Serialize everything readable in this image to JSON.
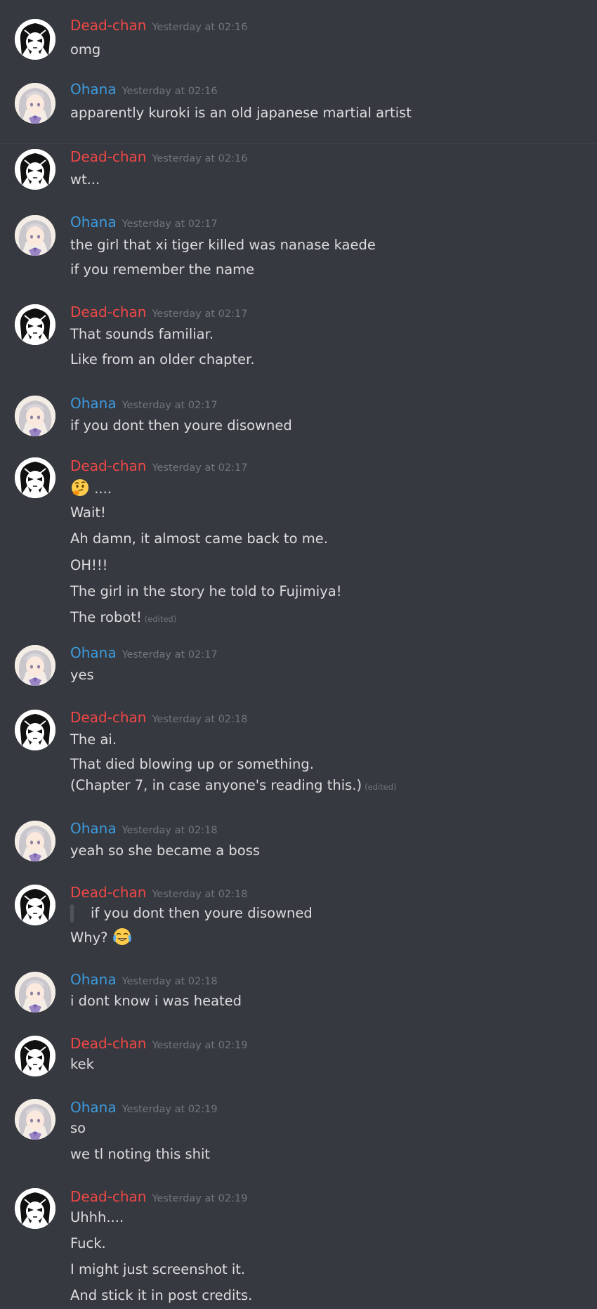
{
  "authors": {
    "dead": "Dead-chan",
    "ohana": "Ohana"
  },
  "messages": [
    {
      "author": "Dead-chan",
      "timestamp": "Yesterday at 02:16",
      "lines": [
        "omg"
      ]
    },
    {
      "author": "Ohana",
      "timestamp": "Yesterday at 02:16",
      "lines": [
        "apparently kuroki is an old japanese martial artist"
      ]
    },
    {
      "author": "Dead-chan",
      "timestamp": "Yesterday at 02:16",
      "lines": [
        "wt..."
      ]
    },
    {
      "author": "Ohana",
      "timestamp": "Yesterday at 02:17",
      "lines": [
        "the girl that xi tiger killed was nanase kaede",
        "if you remember the name"
      ]
    },
    {
      "author": "Dead-chan",
      "timestamp": "Yesterday at 02:17",
      "lines": [
        "That sounds familiar.",
        "Like from an older chapter."
      ]
    },
    {
      "author": "Ohana",
      "timestamp": "Yesterday at 02:17",
      "lines": [
        "if you dont then youre disowned"
      ]
    },
    {
      "author": "Dead-chan",
      "timestamp": "Yesterday at 02:17",
      "lines": [
        "....",
        "Wait!",
        "Ah damn, it almost came back to me.",
        "OH!!!",
        "The girl in the story he told to Fujimiya!",
        "The robot!"
      ],
      "edited": "(edited)",
      "emoji": "thinking-emoji"
    },
    {
      "author": "Ohana",
      "timestamp": "Yesterday at 02:17",
      "lines": [
        "yes"
      ]
    },
    {
      "author": "Dead-chan",
      "timestamp": "Yesterday at 02:18",
      "lines": [
        "The ai.",
        "That died blowing up or something.",
        "(Chapter 7, in case anyone's reading this.)"
      ],
      "edited": "(edited)"
    },
    {
      "author": "Ohana",
      "timestamp": "Yesterday at 02:18",
      "lines": [
        "yeah so she became a boss"
      ]
    },
    {
      "author": "Dead-chan",
      "timestamp": "Yesterday at 02:18",
      "lines": [
        "if you dont then youre disowned",
        "Why?"
      ],
      "quote": true,
      "emoji": "joy-emoji"
    },
    {
      "author": "Ohana",
      "timestamp": "Yesterday at 02:18",
      "lines": [
        "i dont know i was heated"
      ]
    },
    {
      "author": "Dead-chan",
      "timestamp": "Yesterday at 02:19",
      "lines": [
        "kek"
      ]
    },
    {
      "author": "Ohana",
      "timestamp": "Yesterday at 02:19",
      "lines": [
        "so",
        "we tl noting this shit"
      ]
    },
    {
      "author": "Dead-chan",
      "timestamp": "Yesterday at 02:19",
      "lines": [
        "Uhhh....",
        "Fuck.",
        "I might just screenshot it.",
        "And stick it in post credits."
      ]
    }
  ],
  "colors": {
    "background": "#36393f",
    "dead_chan_name": "#f04747",
    "ohana_name": "#3d9bdf",
    "text": "#dcddde",
    "timestamp": "#72767d"
  }
}
